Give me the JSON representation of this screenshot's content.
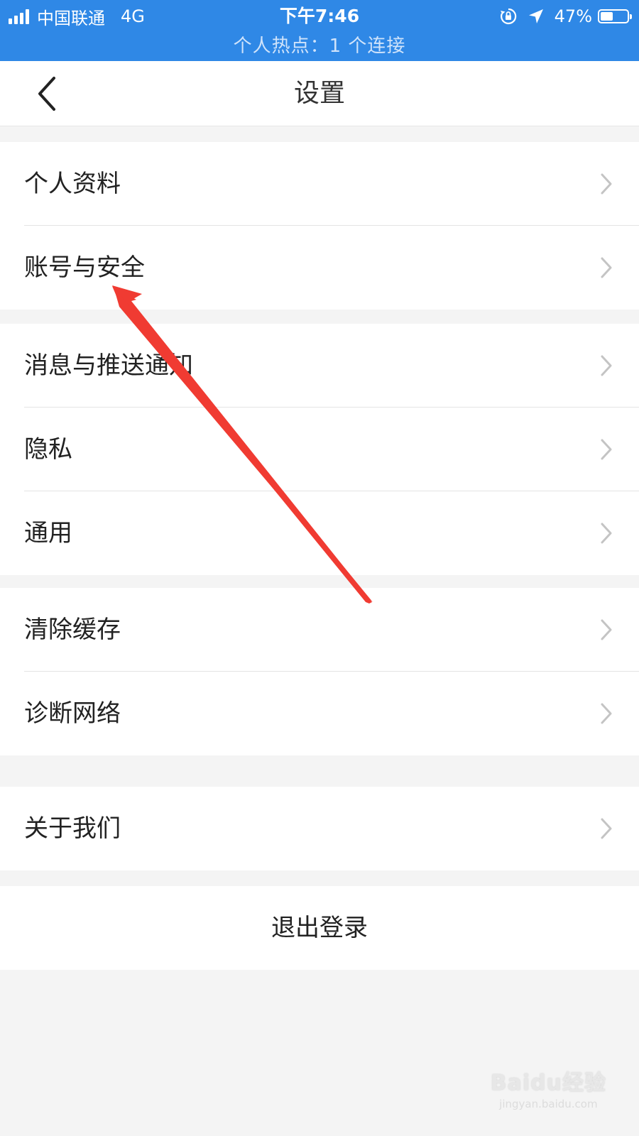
{
  "status_bar": {
    "carrier": "中国联通",
    "network": "4G",
    "time": "下午7:46",
    "battery_percent": "47%",
    "battery_level": 0.47,
    "hotspot_text": "个人热点：1 个连接",
    "color": "#2f88e6"
  },
  "nav": {
    "title": "设置",
    "back_icon": "chevron-left-icon"
  },
  "groups": [
    {
      "items": [
        "个人资料",
        "账号与安全"
      ]
    },
    {
      "items": [
        "消息与推送通知",
        "隐私",
        "通用"
      ]
    },
    {
      "items": [
        "清除缓存",
        "诊断网络"
      ]
    },
    {
      "items": [
        "关于我们"
      ]
    }
  ],
  "logout_label": "退出登录",
  "annotation": {
    "type": "red-arrow",
    "color": "#f03b32",
    "points_to": "账号与安全"
  },
  "watermark": {
    "main": "Baidu经验",
    "sub": "jingyan.baidu.com"
  }
}
